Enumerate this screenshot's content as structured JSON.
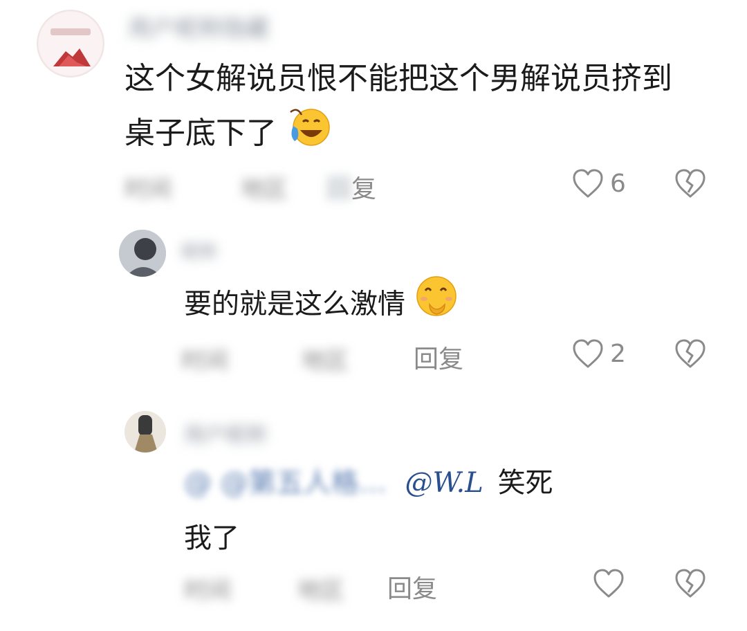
{
  "comment_1": {
    "username_blurred": "用户昵称隐藏",
    "text_line1": "这个女解说员恨不能把这个男解说员挤到",
    "text_line2": "桌子底下了",
    "emoji": "crying-laughing-emoji",
    "time_blurred": "时间",
    "location_blurred": "地区",
    "reply_prefix_blurred": "回",
    "reply_label": "复",
    "like_count": "6"
  },
  "reply_1": {
    "username_blurred": "昵称",
    "text": "要的就是这么激情",
    "emoji": "giggling-emoji",
    "time_blurred": "时间",
    "location_blurred": "地区",
    "reply_label": "回复",
    "like_count": "2"
  },
  "reply_2": {
    "username_blurred": "用户昵称",
    "quote_blurred": "@ @第五人格…",
    "mention": "@W.L",
    "text_after_mention": "笑死",
    "text_line2": "我了",
    "time_blurred": "时间",
    "location_blurred": "地区",
    "reply_label": "回复"
  },
  "icons": {
    "like": "heart-outline-icon",
    "dislike": "broken-heart-icon"
  },
  "colors": {
    "mention": "#2a4f8f",
    "meta": "#8a8a8a",
    "text": "#1b1b1b"
  }
}
